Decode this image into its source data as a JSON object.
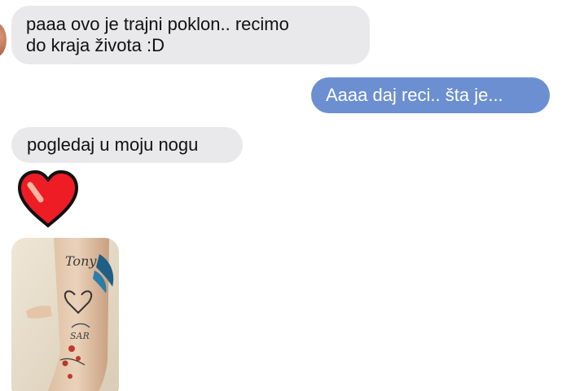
{
  "messages": [
    {
      "direction": "incoming",
      "lines": [
        "paaa ovo je trajni poklon.. recimo",
        "do kraja života :D"
      ]
    },
    {
      "direction": "outgoing",
      "text": "Aaaa daj reci.. šta je..."
    },
    {
      "direction": "incoming",
      "text": "pogledaj u moju nogu"
    }
  ],
  "emoji": {
    "icon": "red-heart-icon",
    "color": "#ee1c25"
  },
  "attachment": {
    "type": "photo",
    "description_icon": "tattooed-leg-photo"
  },
  "colors": {
    "incoming_bubble": "#e9e9eb",
    "outgoing_bubble": "#6b8fd1",
    "outgoing_text": "#ffffff",
    "incoming_text": "#111111"
  }
}
